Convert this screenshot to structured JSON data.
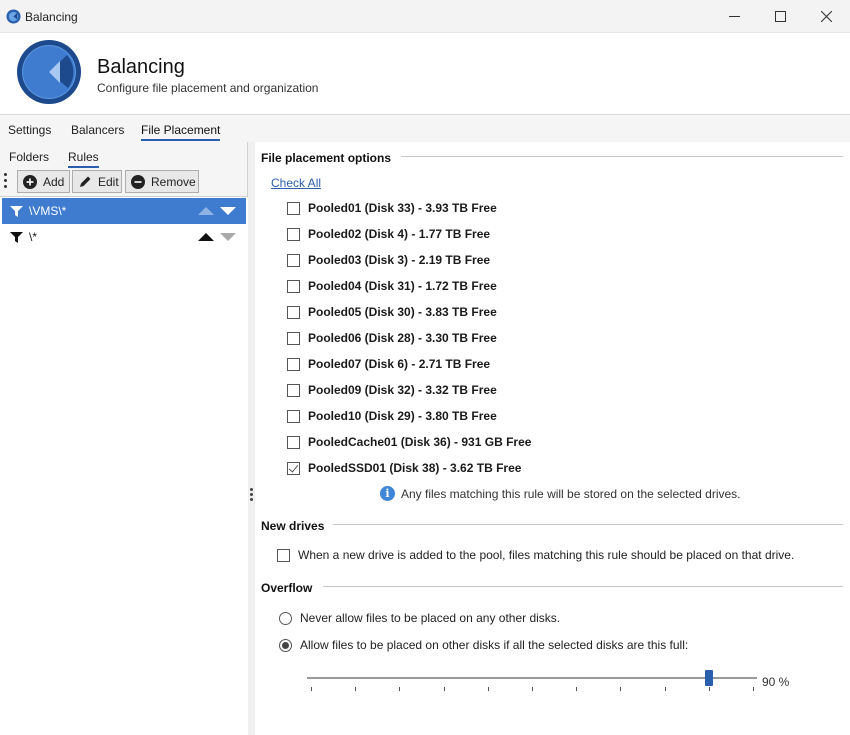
{
  "window": {
    "title": "Balancing",
    "app_icon": "drivepool-icon",
    "controls": [
      "minimize-icon",
      "maximize-icon",
      "close-icon"
    ]
  },
  "header": {
    "title": "Balancing",
    "subtitle": "Configure file placement and organization"
  },
  "tabs": [
    {
      "label": "Settings"
    },
    {
      "label": "Balancers"
    },
    {
      "label": "File Placement",
      "active": true
    }
  ],
  "left": {
    "subtabs": [
      {
        "label": "Folders"
      },
      {
        "label": "Rules",
        "active": true
      }
    ],
    "toolbar": {
      "add_label": "Add",
      "edit_label": "Edit",
      "remove_label": "Remove"
    },
    "rules": [
      {
        "label": "\\VMS\\*",
        "selected": true
      },
      {
        "label": "\\*",
        "selected": false
      }
    ]
  },
  "placement": {
    "section_title": "File placement options",
    "check_all": "Check All",
    "drives": [
      {
        "label": "Pooled01 (Disk 33) - 3.93 TB Free",
        "checked": false
      },
      {
        "label": "Pooled02 (Disk 4) - 1.77 TB Free",
        "checked": false
      },
      {
        "label": "Pooled03 (Disk 3) - 2.19 TB Free",
        "checked": false
      },
      {
        "label": "Pooled04 (Disk 31) - 1.72 TB Free",
        "checked": false
      },
      {
        "label": "Pooled05 (Disk 30) - 3.83 TB Free",
        "checked": false
      },
      {
        "label": "Pooled06 (Disk 28) - 3.30 TB Free",
        "checked": false
      },
      {
        "label": "Pooled07 (Disk 6) - 2.71 TB Free",
        "checked": false
      },
      {
        "label": "Pooled09 (Disk 32) - 3.32 TB Free",
        "checked": false
      },
      {
        "label": "Pooled10 (Disk 29) - 3.80 TB Free",
        "checked": false
      },
      {
        "label": "PooledCache01 (Disk 36) - 931 GB Free",
        "checked": false
      },
      {
        "label": "PooledSSD01 (Disk 38) - 3.62 TB Free",
        "checked": true
      }
    ],
    "info_text": "Any files matching this rule will be stored on the selected drives."
  },
  "new_drives": {
    "section_title": "New drives",
    "option_label": "When a new drive is added to the pool, files matching this rule should be placed on that drive.",
    "checked": false
  },
  "overflow": {
    "section_title": "Overflow",
    "never_label": "Never allow files to be placed on any other disks.",
    "allow_label": "Allow files to be placed on other disks if all the selected disks are this full:",
    "selected": "allow",
    "slider_value": 90,
    "slider_display": "90 %"
  },
  "colors": {
    "accent": "#2a5fad",
    "selected_row": "#3f7bcf",
    "info": "#3f86d8"
  }
}
